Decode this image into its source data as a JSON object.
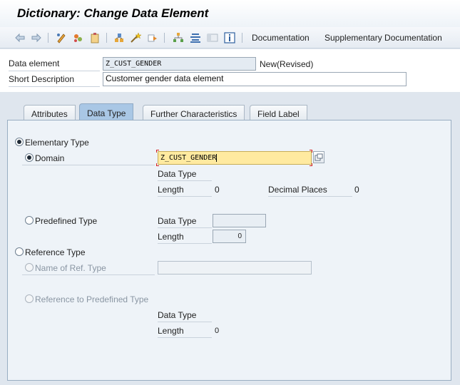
{
  "window": {
    "title": "Dictionary: Change Data Element"
  },
  "toolbar": {
    "documentation_label": "Documentation",
    "supplementary_label": "Supplementary Documentation",
    "icons": [
      "back-arrow-icon",
      "forward-arrow-icon",
      "display-change-icon",
      "other-object-icon",
      "check-icon",
      "activate-icon",
      "where-used-icon",
      "object-list-icon",
      "navigation-icon",
      "hierarchy-icon",
      "display-object-list-icon",
      "info-icon"
    ]
  },
  "header": {
    "data_element_label": "Data element",
    "data_element_value": "Z_CUST_GENDER",
    "status": "New(Revised)",
    "short_desc_label": "Short Description",
    "short_desc_value": "Customer gender data element"
  },
  "tabs": [
    {
      "label": "Attributes",
      "active": false
    },
    {
      "label": "Data Type",
      "active": true
    },
    {
      "label": "Further Characteristics",
      "active": false
    },
    {
      "label": "Field Label",
      "active": false
    }
  ],
  "data_type": {
    "elementary_label": "Elementary Type",
    "domain_label": "Domain",
    "domain_value": "Z_CUST_GENDER",
    "domain_data_type_label": "Data Type",
    "domain_length_label": "Length",
    "domain_length_value": "0",
    "decimal_places_label": "Decimal Places",
    "decimal_places_value": "0",
    "predefined_label": "Predefined Type",
    "predefined_data_type_label": "Data Type",
    "predefined_length_label": "Length",
    "predefined_length_value": "0",
    "reference_label": "Reference Type",
    "ref_name_label": "Name of Ref. Type",
    "ref_predefined_label": "Reference to Predefined Type",
    "ref_data_type_label": "Data Type",
    "ref_length_label": "Length",
    "ref_length_value": "0"
  },
  "colors": {
    "active_tab": "#a9c7e5",
    "required_field": "#ffeaa0",
    "panel": "#eef3f8"
  }
}
